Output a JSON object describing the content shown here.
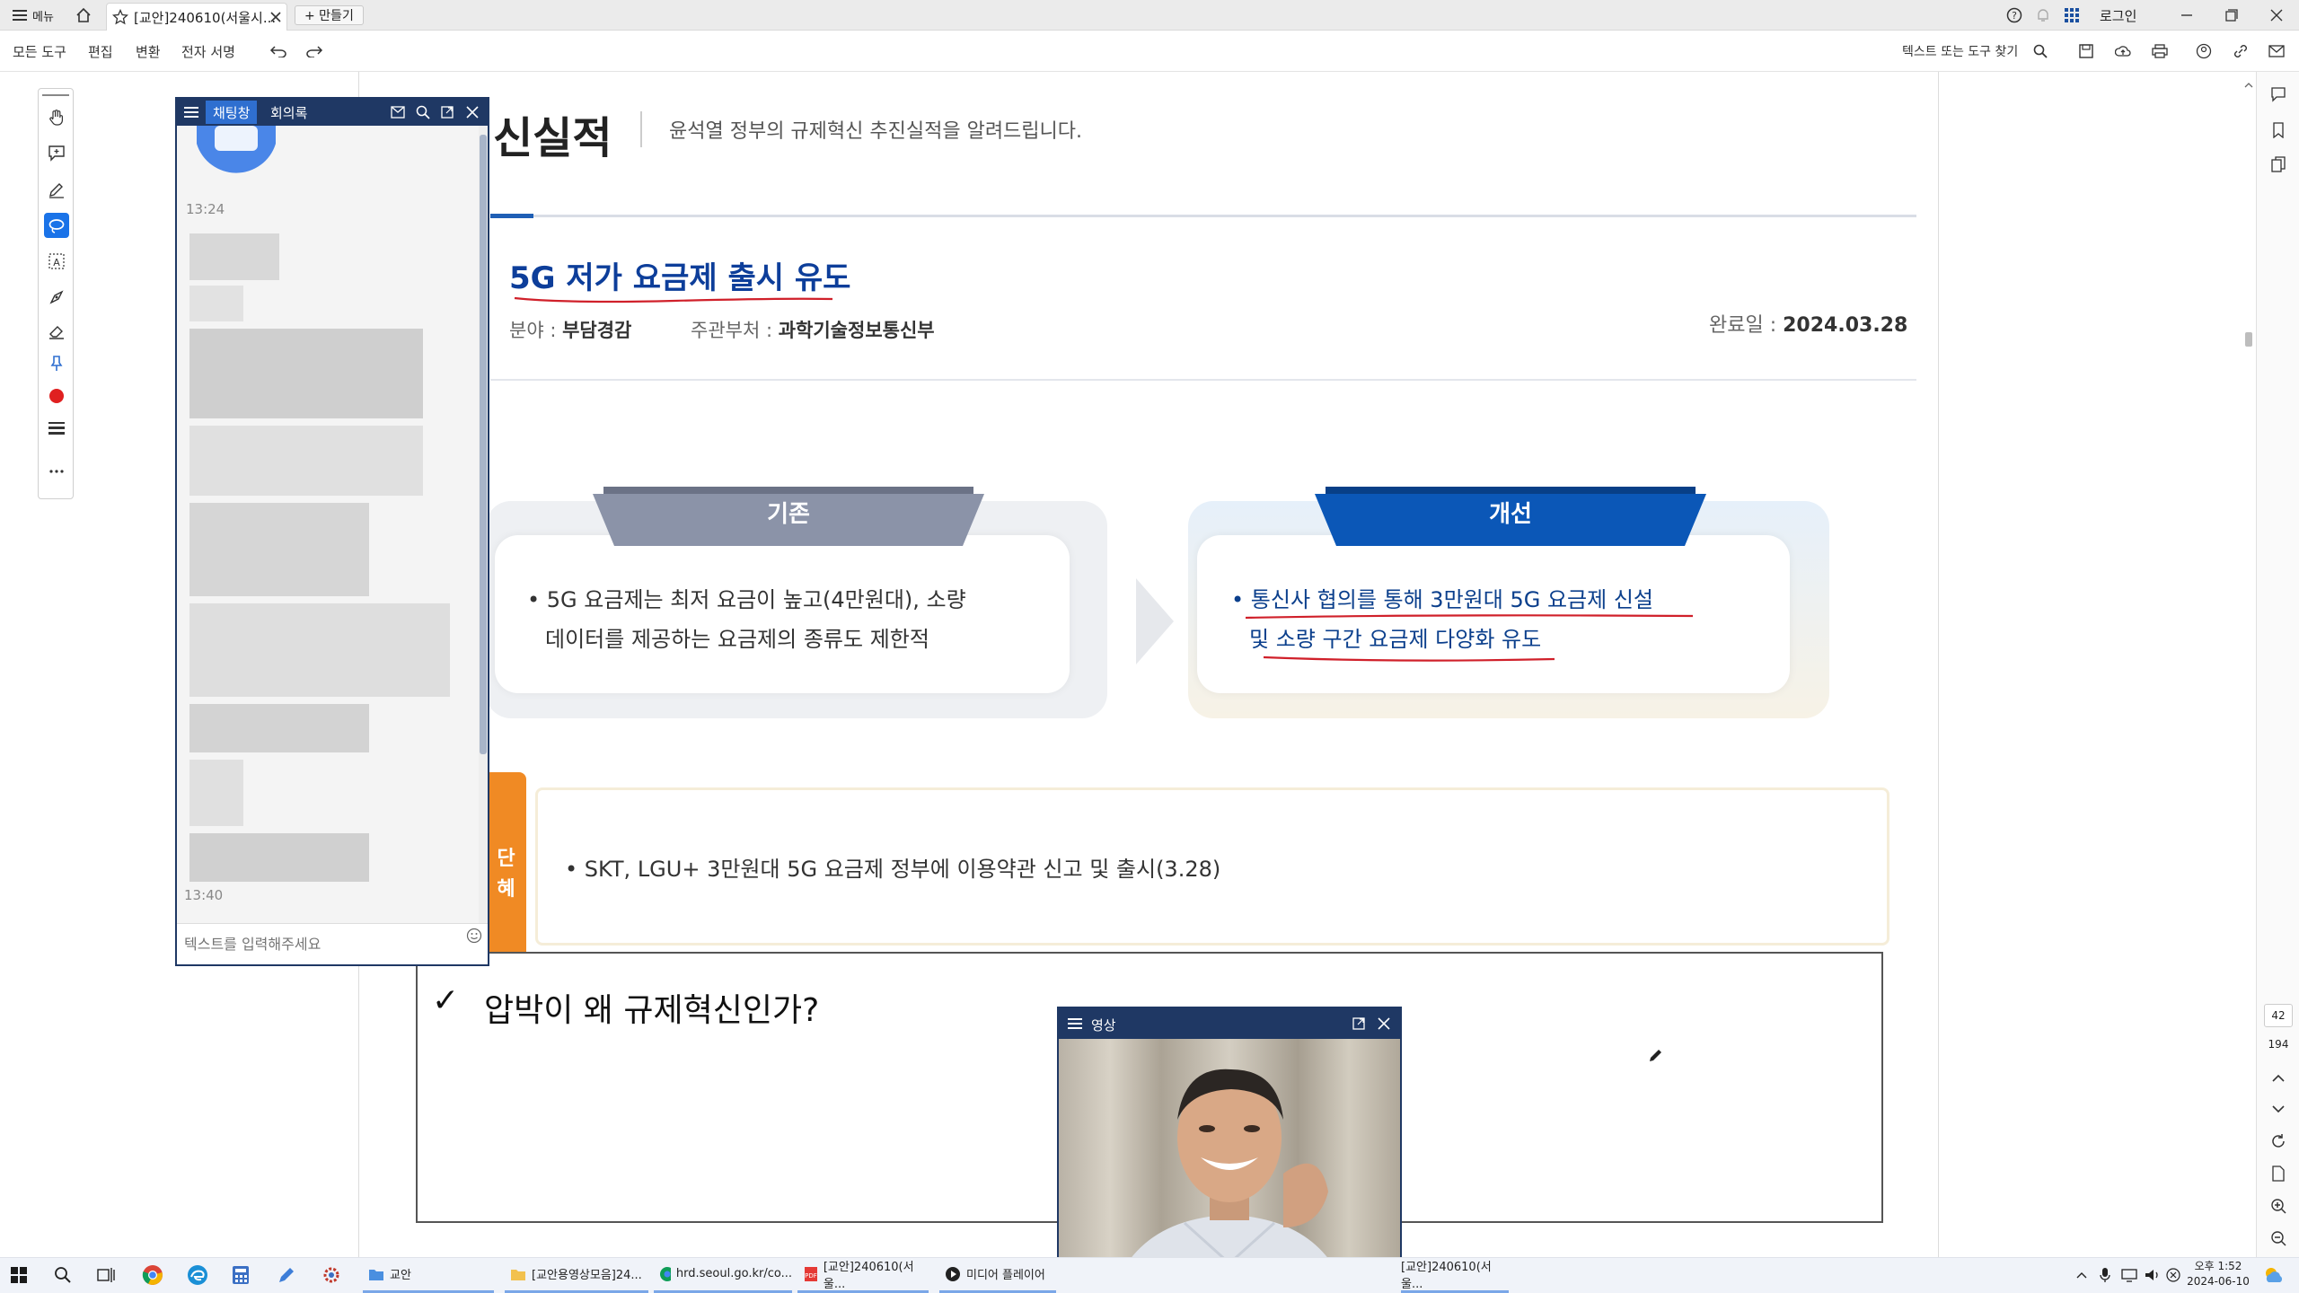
{
  "titlebar": {
    "menu_label": "메뉴",
    "tab_title": "[교안]240610(서울시...",
    "new_tab_label": "+ 만들기",
    "login_label": "로그인"
  },
  "menubar": {
    "items": [
      "모든 도구",
      "편집",
      "변환",
      "전자 서명"
    ],
    "search_label": "텍스트 또는 도구 찾기"
  },
  "document": {
    "section_title": "신실적",
    "section_subtitle": "윤석열 정부의 규제혁신 추진실적을 알려드립니다.",
    "card_title": "5G 저가 요금제 출시 유도",
    "field_label": "분야 : ",
    "field_value": "부담경감",
    "dept_label": "주관부처 : ",
    "dept_value": "과학기술정보통신부",
    "done_label": "완료일 : ",
    "done_value": "2024.03.28",
    "before_header": "기존",
    "before_line1": "• 5G 요금제는 최저 요금이 높고(4만원대), 소량",
    "before_line2": "데이터를 제공하는 요금제의 종류도 제한적",
    "after_header": "개선",
    "after_line1": "• 통신사 협의를 통해 3만원대 5G 요금제 신설",
    "after_line2": "및 소량 구간 요금제 다양화 유도",
    "result_tab_line1": "단",
    "result_tab_line2": "혜",
    "result_text": "• SKT, LGU+ 3만원대 5G 요금제 정부에 이용약관 신고 및 출시(3.28)",
    "note_check": "✓",
    "note_text": "압박이 왜 규제혁신인가?"
  },
  "chat": {
    "tab_chat": "채팅창",
    "tab_minutes": "회의록",
    "time_top": "13:24",
    "time_bottom": "13:40",
    "input_placeholder": "텍스트를 입력해주세요"
  },
  "video": {
    "title": "영상"
  },
  "page_nav": {
    "current": "42",
    "total": "194"
  },
  "taskbar": {
    "apps": [
      "교안",
      "[교안용영상모음]24...",
      "hrd.seoul.go.kr/co...",
      "[교안]240610(서울...",
      "미디어 플레이어",
      "[교안]240610(서울..."
    ],
    "time": "오후 1:52",
    "date": "2024-06-10"
  },
  "colors": {
    "accent_blue": "#1a73e8",
    "chat_header": "#1f3864",
    "improve_blue": "#0b57b7",
    "before_gray": "#8b93a8",
    "annotation_red": "#d0202a",
    "result_orange": "#f08a24"
  }
}
